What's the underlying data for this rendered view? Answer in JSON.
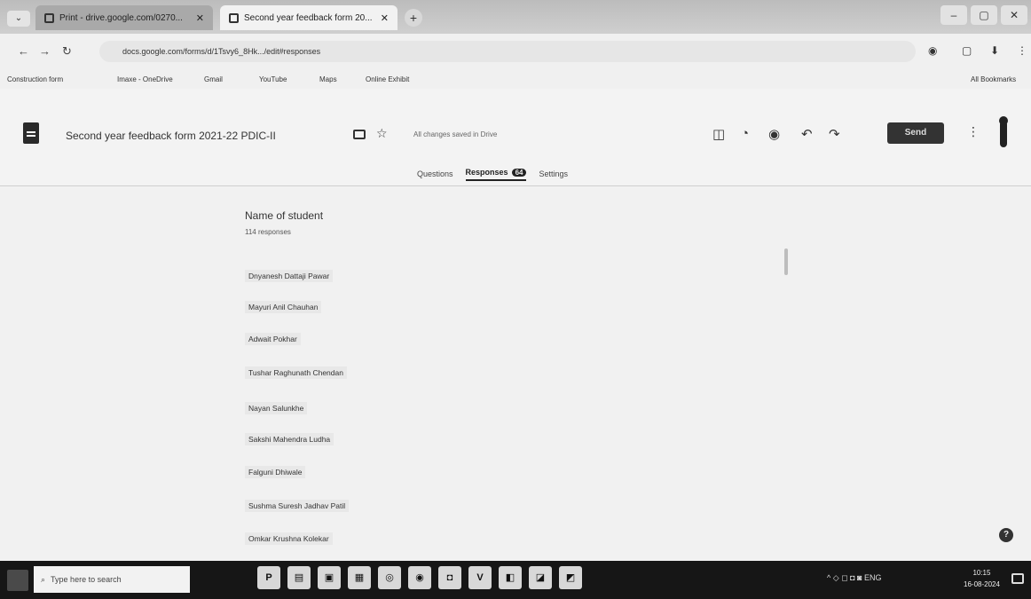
{
  "browser": {
    "tabs": [
      {
        "label": "Print - drive.google.com/0270..."
      },
      {
        "label": "Second year feedback form 20..."
      }
    ],
    "new_tab_symbol": "+",
    "window_controls": [
      "–",
      "▢",
      "✕"
    ],
    "url": "docs.google.com/forms/d/1Tsvy6_8Hk.../edit#responses",
    "bookmarks": [
      "Construction form",
      "Imaxe - OneDrive",
      "Gmail",
      "YouTube",
      "Maps",
      "Online Exhibit"
    ],
    "all_bookmarks": "All Bookmarks"
  },
  "form": {
    "title": "Second year feedback form 2021-22 PDIC-II",
    "saved_status": "All changes saved in Drive",
    "send_label": "Send",
    "tabs": {
      "questions": "Questions",
      "responses": "Responses",
      "responses_count": "64",
      "settings": "Settings"
    }
  },
  "question": {
    "title": "Name of student",
    "count_label": "114 responses",
    "responses": [
      "Dnyanesh Dattaji Pawar",
      "Mayuri Anil Chauhan",
      "Adwait Pokhar",
      "Tushar Raghunath Chendan",
      "Nayan Salunkhe",
      "Sakshi Mahendra Ludha",
      "Falguni Dhiwale",
      "Sushma Suresh Jadhav Patil",
      "Omkar Krushna Kolekar"
    ]
  },
  "taskbar": {
    "search_placeholder": "Type here to search",
    "apps": [
      "P",
      "▤",
      "▣",
      "▦",
      "◎",
      "◉",
      "◘",
      "V",
      "◧",
      "◪",
      "◩"
    ],
    "tray_text": "^ ◇ ◻ ◘ ◙ ENG",
    "time": "10:15",
    "date": "16-08-2024"
  },
  "icons": {
    "help": "?",
    "more": "⋮",
    "star": "☆"
  }
}
